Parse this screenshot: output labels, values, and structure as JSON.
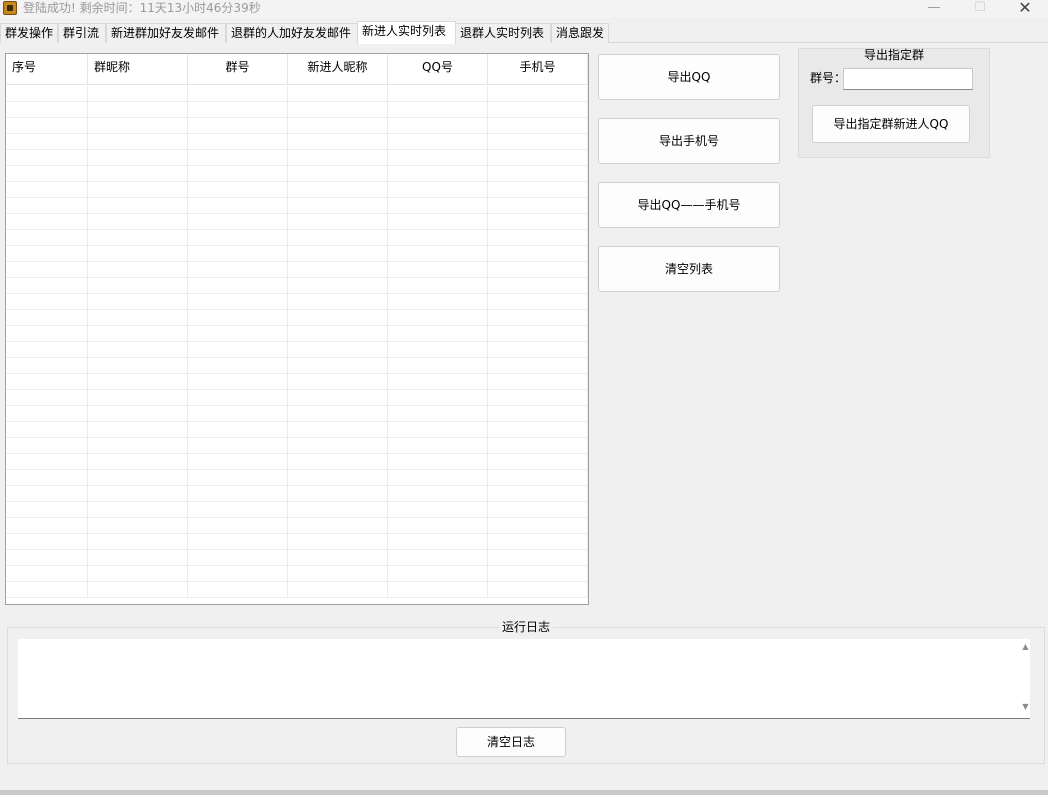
{
  "window": {
    "title": "登陆成功! 剩余时间：11天13小时46分39秒",
    "minimize_glyph": "—",
    "maximize_glyph": "☐",
    "close_glyph": "✕"
  },
  "tabs": [
    {
      "label": "群发操作",
      "active": false
    },
    {
      "label": "群引流",
      "active": false
    },
    {
      "label": "新进群加好友发邮件",
      "active": false
    },
    {
      "label": "退群的人加好友发邮件",
      "active": false
    },
    {
      "label": "新进人实时列表",
      "active": true
    },
    {
      "label": "退群人实时列表",
      "active": false
    },
    {
      "label": "消息跟发",
      "active": false
    }
  ],
  "table": {
    "columns": [
      "序号",
      "群昵称",
      "群号",
      "新进人昵称",
      "QQ号",
      "手机号"
    ],
    "rows": []
  },
  "actions": {
    "export_qq": "导出QQ",
    "export_phone": "导出手机号",
    "export_qq_phone": "导出QQ——手机号",
    "clear_list": "清空列表"
  },
  "export_group": {
    "title": "导出指定群",
    "group_label": "群号：",
    "group_value": "",
    "export_button": "导出指定群新进人QQ"
  },
  "log": {
    "title": "运行日志",
    "content": "",
    "clear_button": "清空日志"
  }
}
